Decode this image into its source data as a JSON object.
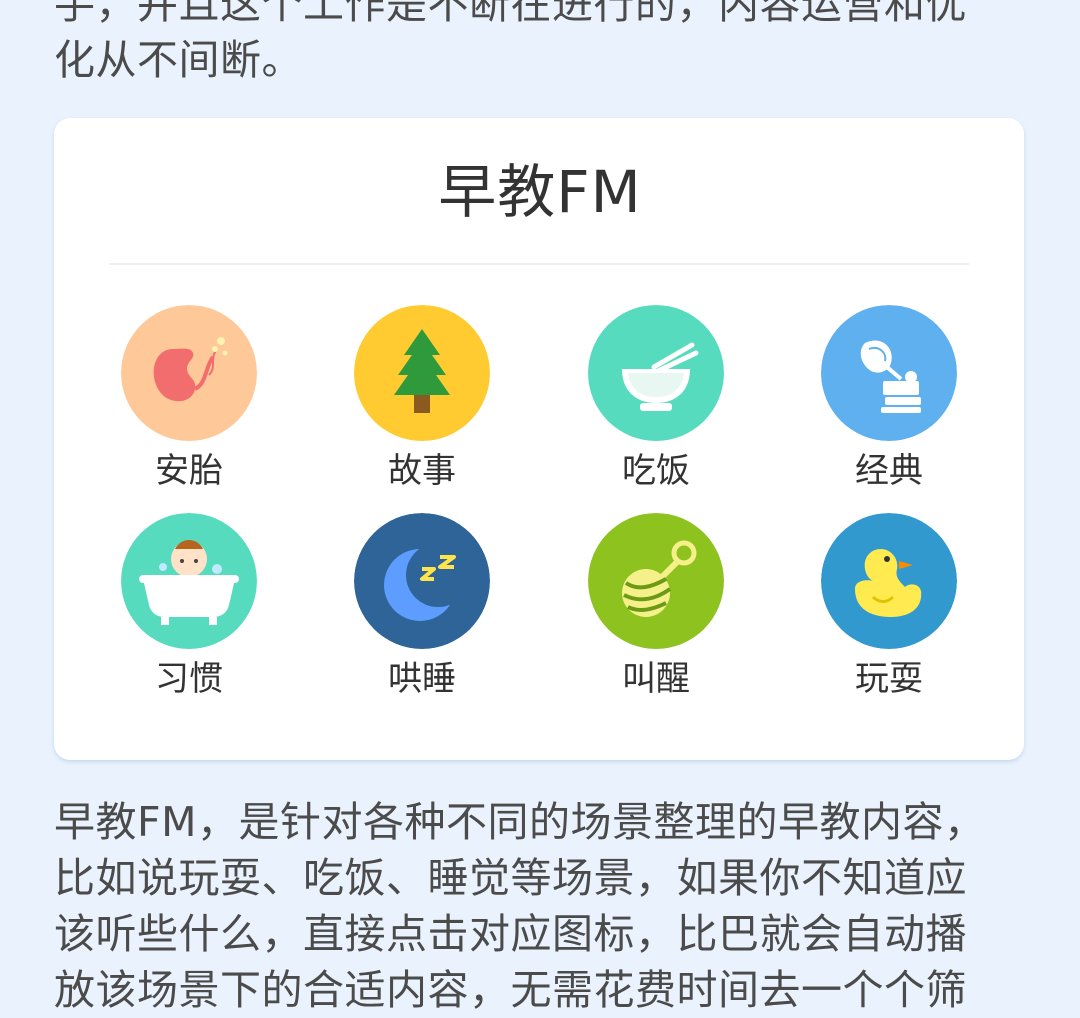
{
  "intro_text": {
    "line1": "手，并且这个工作是不断在进行的，内容运营和优",
    "line2": "化从不间断。"
  },
  "card": {
    "title": "早教FM",
    "items": [
      {
        "label": "安胎",
        "icon": "fetus-icon",
        "color": "#ffc898"
      },
      {
        "label": "故事",
        "icon": "pine-tree-icon",
        "color": "#ffcb31"
      },
      {
        "label": "吃饭",
        "icon": "rice-bowl-icon",
        "color": "#56dbbe"
      },
      {
        "label": "经典",
        "icon": "gramophone-icon",
        "color": "#5fb0ee"
      },
      {
        "label": "习惯",
        "icon": "baby-bathtub-icon",
        "color": "#56dbbe"
      },
      {
        "label": "哄睡",
        "icon": "moon-sleep-icon",
        "color": "#2e6497"
      },
      {
        "label": "叫醒",
        "icon": "rattle-icon",
        "color": "#8dc21f"
      },
      {
        "label": "玩耍",
        "icon": "rubber-duck-icon",
        "color": "#3299cf"
      }
    ]
  },
  "body_text": {
    "line1": "早教FM，是针对各种不同的场景整理的早教内容，",
    "line2": "比如说玩耍、吃饭、睡觉等场景，如果你不知道应",
    "line3": "该听些什么，直接点击对应图标，比巴就会自动播",
    "line4": "放该场景下的合适内容，无需花费时间去一个个筛"
  }
}
